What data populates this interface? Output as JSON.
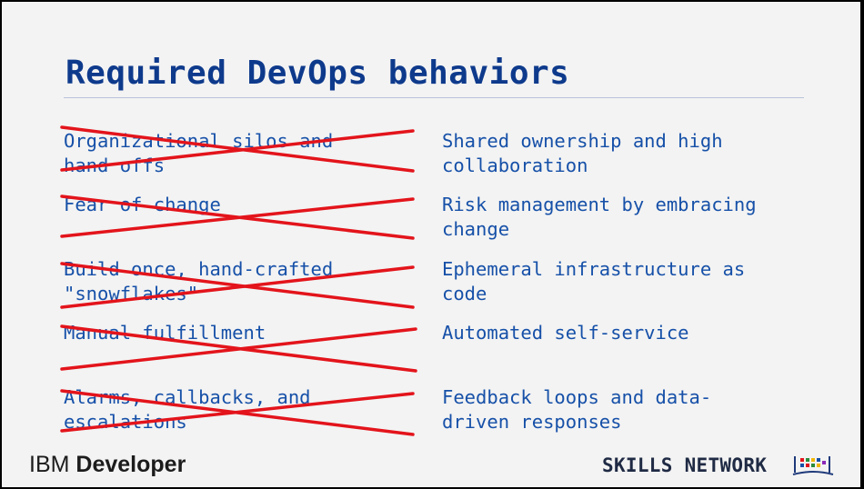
{
  "slide": {
    "title": "Required DevOps behaviors",
    "rows": [
      {
        "old": "Organizational silos and\nhand offs",
        "new": "Shared ownership and high\ncollaboration"
      },
      {
        "old": "Fear of change",
        "new": "Risk management by embracing\nchange"
      },
      {
        "old": "Build once, hand-crafted\n\"snowflakes\"",
        "new": "Ephemeral infrastructure as\ncode"
      },
      {
        "old": "Manual fulfillment",
        "new": "Automated self-service"
      },
      {
        "old": "Alarms, callbacks, and\nescalations",
        "new": "Feedback loops and data-\ndriven responses"
      }
    ]
  },
  "branding": {
    "left_logo_prefix": "IBM",
    "left_logo_word": "Developer",
    "right_logo": "SKILLS NETWORK",
    "right_logo_icon": "books-icon"
  },
  "colors": {
    "title": "#0e3a8c",
    "text": "#1650a8",
    "strike": "#e3141b",
    "background": "#f3f3f3"
  }
}
